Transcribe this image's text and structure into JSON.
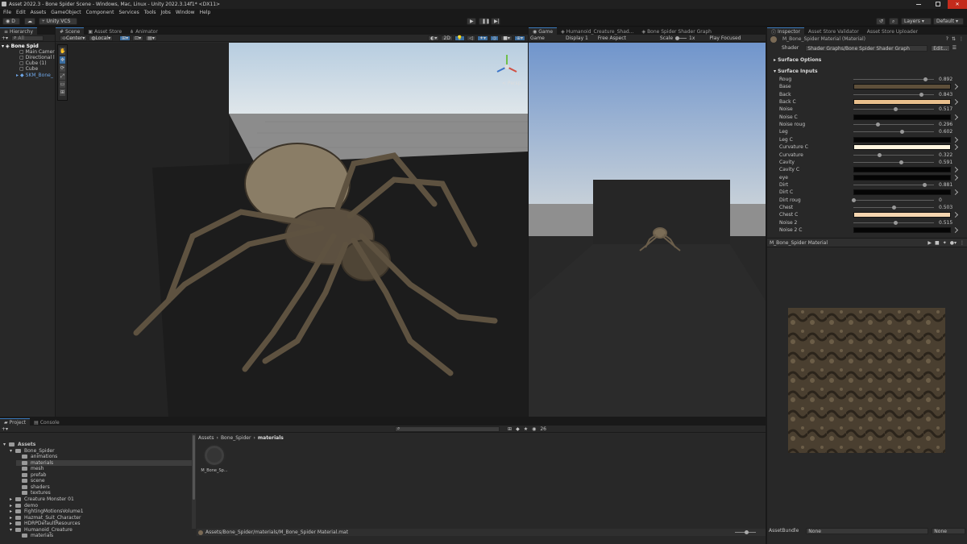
{
  "window": {
    "title": "Asset 2022.3 - Bone Spider Scene - Windows, Mac, Linux - Unity 2022.3.14f1* <DX11>"
  },
  "menu": [
    "File",
    "Edit",
    "Assets",
    "GameObject",
    "Component",
    "Services",
    "Tools",
    "Jobs",
    "Window",
    "Help"
  ],
  "toolbar": {
    "account": "D",
    "vcs": "Unity VCS",
    "layers": "Layers",
    "layout": "Default"
  },
  "hierarchy": {
    "tab": "Hierarchy",
    "search_placeholder": "All",
    "items": [
      "Bone Spid",
      "Main Camer",
      "Directional l",
      "Cube (1)",
      "Cube",
      "SKM_Bone_"
    ]
  },
  "scene": {
    "tabs": [
      "Scene",
      "Asset Store",
      "Animator"
    ],
    "pivot": "Center",
    "space": "Local",
    "persp": "< Persp"
  },
  "game": {
    "tabs": [
      "Game",
      "Humanoid_Creature_Shad...",
      "Bone Spider Shader Graph"
    ],
    "mode": "Game",
    "display": "Display 1",
    "aspect": "Free Aspect",
    "scale_label": "Scale",
    "scale_value": "1x",
    "play_mode": "Play Focused"
  },
  "inspector": {
    "tabs": [
      "Inspector",
      "Asset Store Validator",
      "Asset Store Uploader"
    ],
    "material_name": "M_Bone_Spider Material (Material)",
    "shader_label": "Shader",
    "shader_value": "Shader Graphs/Bone Spider Shader Graph",
    "edit_label": "Edit...",
    "surface_options": "Surface Options",
    "surface_inputs": "Surface Inputs",
    "properties": [
      {
        "label": "Roug",
        "kind": "slider",
        "value": "0.892",
        "frac": 0.892
      },
      {
        "label": "Base",
        "kind": "color",
        "color": "#5e4f3a"
      },
      {
        "label": "Back",
        "kind": "slider",
        "value": "0.843",
        "frac": 0.843
      },
      {
        "label": "Back C",
        "kind": "color",
        "color": "#e9bf8c"
      },
      {
        "label": "Noise",
        "kind": "slider",
        "value": "0.517",
        "frac": 0.517
      },
      {
        "label": "Noise C",
        "kind": "color",
        "color": "#050505"
      },
      {
        "label": "Noise roug",
        "kind": "slider",
        "value": "0.296",
        "frac": 0.296
      },
      {
        "label": "Leg",
        "kind": "slider",
        "value": "0.602",
        "frac": 0.602
      },
      {
        "label": "Leg C",
        "kind": "color",
        "color": "#050505"
      },
      {
        "label": "Curvature C",
        "kind": "color",
        "color": "#fff6e0"
      },
      {
        "label": "Curvature",
        "kind": "slider",
        "value": "0.322",
        "frac": 0.322
      },
      {
        "label": "Cavity",
        "kind": "slider",
        "value": "0.591",
        "frac": 0.591
      },
      {
        "label": "Cavity C",
        "kind": "color",
        "color": "#050505"
      },
      {
        "label": "eye",
        "kind": "color",
        "color": "#050505"
      },
      {
        "label": "Dirt",
        "kind": "slider",
        "value": "0.881",
        "frac": 0.881
      },
      {
        "label": "Dirt C",
        "kind": "color",
        "color": "#050505"
      },
      {
        "label": "Dirt roug",
        "kind": "slider",
        "value": "0",
        "frac": 0
      },
      {
        "label": "Chest",
        "kind": "slider",
        "value": "0.503",
        "frac": 0.503
      },
      {
        "label": "Chest C",
        "kind": "color",
        "color": "#f5d6b0"
      },
      {
        "label": "Noise 2",
        "kind": "slider",
        "value": "0.515",
        "frac": 0.515
      },
      {
        "label": "Noise 2 C",
        "kind": "color",
        "color": "#050505"
      }
    ],
    "preview_title": "M_Bone_Spider Material",
    "assetbundle_label": "AssetBundle",
    "assetbundle_value": "None",
    "assetbundle_variant": "None"
  },
  "project": {
    "tabs": [
      "Project",
      "Console"
    ],
    "count": "26",
    "tree": [
      "Assets",
      "Bone_Spider",
      "animations",
      "materials",
      "mesh",
      "prefab",
      "scene",
      "shaders",
      "textures",
      "Creature Monster 01",
      "demo",
      "FightingMotionsVolume1",
      "Hazmat_Suit_Character",
      "HDRPDefaultResources",
      "Humanoid_Creature",
      "materials"
    ],
    "breadcrumb": [
      "Assets",
      "Bone_Spider",
      "materials"
    ],
    "file_label": "M_Bone_Sp...",
    "status_path": "Assets/Bone_Spider/materials/M_Bone_Spider Material.mat"
  }
}
